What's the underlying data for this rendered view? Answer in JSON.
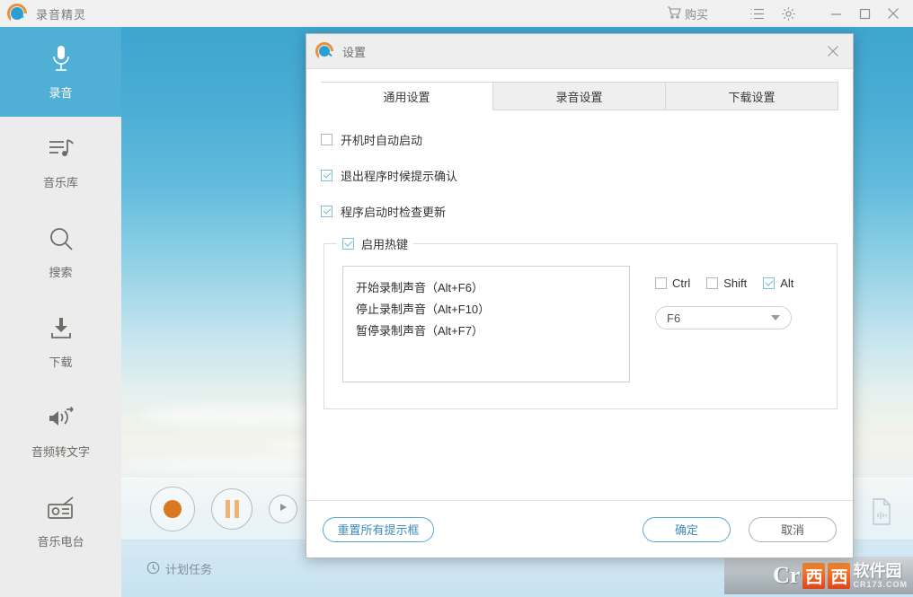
{
  "titlebar": {
    "app_title": "录音精灵",
    "logo_icon": "recorder-logo-icon",
    "buy_label": "购买",
    "buy_icon": "cart-icon",
    "list_icon": "list-icon",
    "gear_icon": "gear-icon",
    "minimize_icon": "minimize-icon",
    "maximize_icon": "maximize-icon",
    "close_icon": "close-icon"
  },
  "sidebar": {
    "items": [
      {
        "label": "录音",
        "icon": "microphone-icon",
        "active": true
      },
      {
        "label": "音乐库",
        "icon": "music-library-icon",
        "active": false
      },
      {
        "label": "搜索",
        "icon": "search-icon",
        "active": false
      },
      {
        "label": "下载",
        "icon": "download-icon",
        "active": false
      },
      {
        "label": "音频转文字",
        "icon": "audio-to-text-icon",
        "active": false
      },
      {
        "label": "音乐电台",
        "icon": "radio-icon",
        "active": false
      }
    ]
  },
  "player": {
    "record_button": "record-button",
    "pause_button": "pause-button",
    "play_button": "play-button",
    "stop_button": "stop-button",
    "waveform_file_icon": "waveform-file-icon"
  },
  "statusbar": {
    "clock_icon": "clock-icon",
    "scheduled_task_label": "计划任务"
  },
  "watermark": {
    "cr": "Cr",
    "xi1": "西",
    "xi2": "西",
    "text": "软件园",
    "url": "CR173.COM"
  },
  "dialog": {
    "title": "设置",
    "logo_icon": "recorder-logo-icon",
    "close_icon": "close-icon",
    "tabs": [
      {
        "label": "通用设置",
        "active": true
      },
      {
        "label": "录音设置",
        "active": false
      },
      {
        "label": "下载设置",
        "active": false
      }
    ],
    "general": {
      "options": [
        {
          "label": "开机时自动启动",
          "checked": false
        },
        {
          "label": "退出程序时候提示确认",
          "checked": true
        },
        {
          "label": "程序启动时检查更新",
          "checked": true
        }
      ],
      "hotkey_group": {
        "legend": "启用热键",
        "legend_checked": true,
        "items": [
          "开始录制声音（Alt+F6）",
          "停止录制声音（Alt+F10）",
          "暂停录制声音（Alt+F7）"
        ],
        "modifiers": [
          {
            "label": "Ctrl",
            "checked": false
          },
          {
            "label": "Shift",
            "checked": false
          },
          {
            "label": "Alt",
            "checked": true
          }
        ],
        "key_value": "F6"
      }
    },
    "footer": {
      "reset_label": "重置所有提示框",
      "ok_label": "确定",
      "cancel_label": "取消"
    }
  },
  "colors": {
    "accent_blue": "#4fafd4",
    "logo_orange": "#e8903a",
    "record_orange": "#d9781f",
    "sidebar_bg": "#ececec"
  }
}
